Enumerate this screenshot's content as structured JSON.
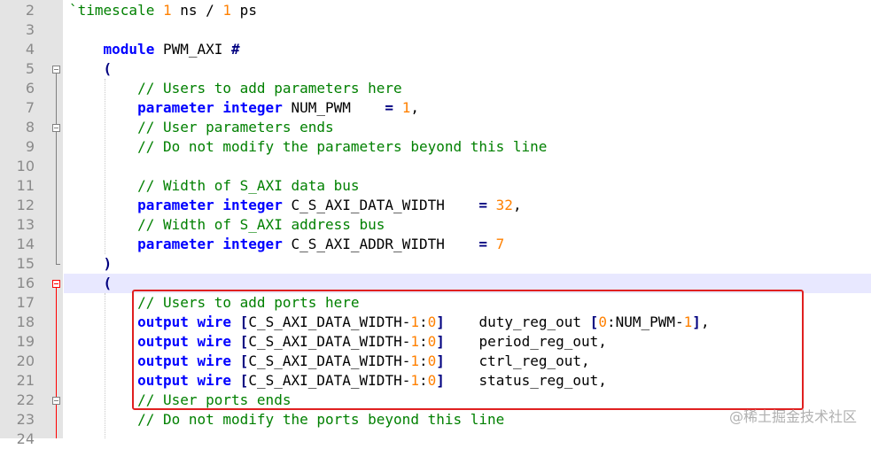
{
  "editor": {
    "lines": [
      {
        "number": "2",
        "tokens": [
          {
            "t": "`timescale ",
            "c": "cm"
          },
          {
            "t": "1",
            "c": "nm"
          },
          {
            "t": " ns / ",
            "c": "tx"
          },
          {
            "t": "1",
            "c": "nm"
          },
          {
            "t": " ps",
            "c": "tx"
          }
        ]
      },
      {
        "number": "3",
        "tokens": []
      },
      {
        "number": "4",
        "tokens": [
          {
            "t": "    ",
            "c": "tx"
          },
          {
            "t": "module",
            "c": "kw"
          },
          {
            "t": " PWM_AXI ",
            "c": "tx"
          },
          {
            "t": "#",
            "c": "op"
          }
        ]
      },
      {
        "number": "5",
        "tokens": [
          {
            "t": "    ",
            "c": "tx"
          },
          {
            "t": "(",
            "c": "op"
          }
        ]
      },
      {
        "number": "6",
        "tokens": [
          {
            "t": "        // Users to add parameters here",
            "c": "cm"
          }
        ]
      },
      {
        "number": "7",
        "tokens": [
          {
            "t": "        ",
            "c": "tx"
          },
          {
            "t": "parameter integer",
            "c": "kw"
          },
          {
            "t": " NUM_PWM    ",
            "c": "tx"
          },
          {
            "t": "=",
            "c": "op"
          },
          {
            "t": " ",
            "c": "tx"
          },
          {
            "t": "1",
            "c": "nm"
          },
          {
            "t": ",",
            "c": "tx"
          }
        ]
      },
      {
        "number": "8",
        "tokens": [
          {
            "t": "        // User parameters ends",
            "c": "cm"
          }
        ]
      },
      {
        "number": "9",
        "tokens": [
          {
            "t": "        // Do not modify the parameters beyond this line",
            "c": "cm"
          }
        ]
      },
      {
        "number": "10",
        "tokens": []
      },
      {
        "number": "11",
        "tokens": [
          {
            "t": "        // Width of S_AXI data bus",
            "c": "cm"
          }
        ]
      },
      {
        "number": "12",
        "tokens": [
          {
            "t": "        ",
            "c": "tx"
          },
          {
            "t": "parameter integer",
            "c": "kw"
          },
          {
            "t": " C_S_AXI_DATA_WIDTH    ",
            "c": "tx"
          },
          {
            "t": "=",
            "c": "op"
          },
          {
            "t": " ",
            "c": "tx"
          },
          {
            "t": "32",
            "c": "nm"
          },
          {
            "t": ",",
            "c": "tx"
          }
        ]
      },
      {
        "number": "13",
        "tokens": [
          {
            "t": "        // Width of S_AXI address bus",
            "c": "cm"
          }
        ]
      },
      {
        "number": "14",
        "tokens": [
          {
            "t": "        ",
            "c": "tx"
          },
          {
            "t": "parameter integer",
            "c": "kw"
          },
          {
            "t": " C_S_AXI_ADDR_WIDTH    ",
            "c": "tx"
          },
          {
            "t": "=",
            "c": "op"
          },
          {
            "t": " ",
            "c": "tx"
          },
          {
            "t": "7",
            "c": "nm"
          }
        ]
      },
      {
        "number": "15",
        "tokens": [
          {
            "t": "    ",
            "c": "tx"
          },
          {
            "t": ")",
            "c": "op"
          }
        ]
      },
      {
        "number": "16",
        "tokens": [
          {
            "t": "    ",
            "c": "tx"
          },
          {
            "t": "(",
            "c": "op"
          }
        ]
      },
      {
        "number": "17",
        "tokens": [
          {
            "t": "        // Users to add ports here",
            "c": "cm"
          }
        ]
      },
      {
        "number": "18",
        "tokens": [
          {
            "t": "        ",
            "c": "tx"
          },
          {
            "t": "output wire",
            "c": "kw"
          },
          {
            "t": " ",
            "c": "tx"
          },
          {
            "t": "[",
            "c": "op"
          },
          {
            "t": "C_S_AXI_DATA_WIDTH-",
            "c": "tx"
          },
          {
            "t": "1",
            "c": "nm"
          },
          {
            "t": ":",
            "c": "tx"
          },
          {
            "t": "0",
            "c": "nm"
          },
          {
            "t": "]",
            "c": "op"
          },
          {
            "t": "    duty_reg_out ",
            "c": "tx"
          },
          {
            "t": "[",
            "c": "op"
          },
          {
            "t": "0",
            "c": "nm"
          },
          {
            "t": ":NUM_PWM-",
            "c": "tx"
          },
          {
            "t": "1",
            "c": "nm"
          },
          {
            "t": "]",
            "c": "op"
          },
          {
            "t": ",",
            "c": "tx"
          }
        ]
      },
      {
        "number": "19",
        "tokens": [
          {
            "t": "        ",
            "c": "tx"
          },
          {
            "t": "output wire",
            "c": "kw"
          },
          {
            "t": " ",
            "c": "tx"
          },
          {
            "t": "[",
            "c": "op"
          },
          {
            "t": "C_S_AXI_DATA_WIDTH-",
            "c": "tx"
          },
          {
            "t": "1",
            "c": "nm"
          },
          {
            "t": ":",
            "c": "tx"
          },
          {
            "t": "0",
            "c": "nm"
          },
          {
            "t": "]",
            "c": "op"
          },
          {
            "t": "    period_reg_out,",
            "c": "tx"
          }
        ]
      },
      {
        "number": "20",
        "tokens": [
          {
            "t": "        ",
            "c": "tx"
          },
          {
            "t": "output wire",
            "c": "kw"
          },
          {
            "t": " ",
            "c": "tx"
          },
          {
            "t": "[",
            "c": "op"
          },
          {
            "t": "C_S_AXI_DATA_WIDTH-",
            "c": "tx"
          },
          {
            "t": "1",
            "c": "nm"
          },
          {
            "t": ":",
            "c": "tx"
          },
          {
            "t": "0",
            "c": "nm"
          },
          {
            "t": "]",
            "c": "op"
          },
          {
            "t": "    ctrl_reg_out,",
            "c": "tx"
          }
        ]
      },
      {
        "number": "21",
        "tokens": [
          {
            "t": "        ",
            "c": "tx"
          },
          {
            "t": "output wire",
            "c": "kw"
          },
          {
            "t": " ",
            "c": "tx"
          },
          {
            "t": "[",
            "c": "op"
          },
          {
            "t": "C_S_AXI_DATA_WIDTH-",
            "c": "tx"
          },
          {
            "t": "1",
            "c": "nm"
          },
          {
            "t": ":",
            "c": "tx"
          },
          {
            "t": "0",
            "c": "nm"
          },
          {
            "t": "]",
            "c": "op"
          },
          {
            "t": "    status_reg_out,",
            "c": "tx"
          }
        ]
      },
      {
        "number": "22",
        "tokens": [
          {
            "t": "        // User ports ends",
            "c": "cm"
          }
        ]
      },
      {
        "number": "23",
        "tokens": [
          {
            "t": "        // Do not modify the ports beyond this line",
            "c": "cm"
          }
        ]
      },
      {
        "number": "24",
        "tokens": []
      }
    ]
  },
  "watermark": "@稀土掘金技术社区",
  "colors": {
    "keyword": "#0000ff",
    "comment": "#008000",
    "number": "#ff8000",
    "current_line": "#e8e8ff",
    "annotation_box": "#e02020"
  }
}
